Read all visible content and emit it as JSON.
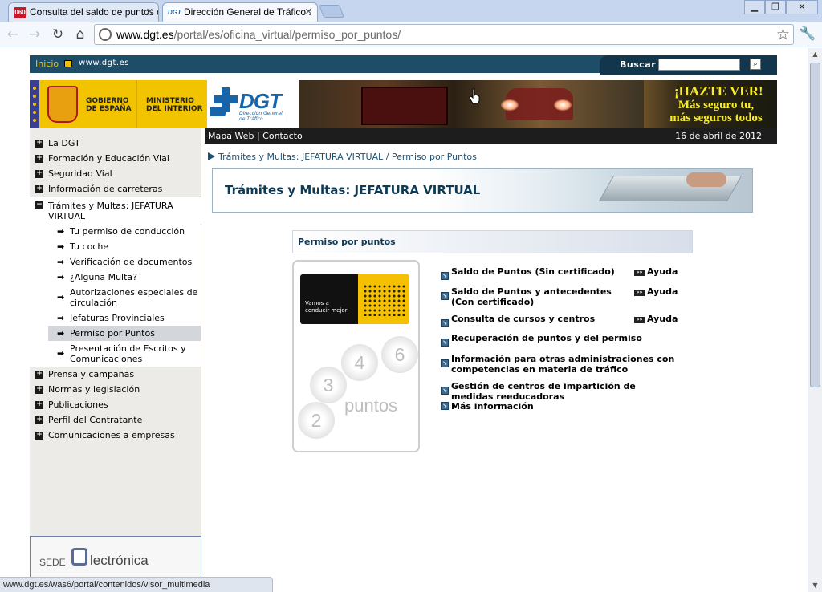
{
  "browser": {
    "tabs": [
      {
        "label": "Consulta del saldo de puntos c",
        "favicon": "060",
        "active": false
      },
      {
        "label": "Dirección General de Tráfico :",
        "favicon": "DGT",
        "active": true
      }
    ],
    "url_host": "www.dgt.es",
    "url_path": "/portal/es/oficina_virtual/permiso_por_puntos/",
    "status_text": "www.dgt.es/was6/portal/contenidos/visor_multimedia"
  },
  "topbar": {
    "inicio": "Inicio",
    "site": "www.dgt.es",
    "search_label": "Buscar",
    "search_value": ""
  },
  "banner": {
    "gobierno_line1": "GOBIERNO",
    "gobierno_line2": "DE ESPAÑA",
    "ministerio_line1": "MINISTERIO",
    "ministerio_line2": "DEL INTERIOR",
    "dgt_word": "DGT",
    "dgt_sub_line1": "Dirección General",
    "dgt_sub_line2": "de Tráfico",
    "hazte_title": "¡HAZTE VER!",
    "hazte_line1": "Más seguro tu,",
    "hazte_line2": "más seguros todos"
  },
  "subbar": {
    "mapa_web": "Mapa Web",
    "separator": "|",
    "contacto": "Contacto",
    "date": "16 de abril de 2012"
  },
  "sidebar": {
    "items_before": [
      {
        "label": "La DGT",
        "sign": "+"
      },
      {
        "label": "Formación y Educación Vial",
        "sign": "+"
      },
      {
        "label": "Seguridad Vial",
        "sign": "+"
      },
      {
        "label": "Información de carreteras",
        "sign": "+"
      }
    ],
    "open_item": {
      "label": "Trámites y Multas: JEFATURA VIRTUAL",
      "sign": "−"
    },
    "sub_items": [
      {
        "label": "Tu permiso de conducción"
      },
      {
        "label": "Tu coche"
      },
      {
        "label": "Verificación de documentos"
      },
      {
        "label": "¿Alguna Multa?"
      },
      {
        "label": "Autorizaciones especiales de circulación"
      },
      {
        "label": "Jefaturas Provinciales"
      },
      {
        "label": "Permiso por Puntos"
      },
      {
        "label": "Presentación de Escritos y Comunicaciones"
      }
    ],
    "items_after": [
      {
        "label": "Prensa y campañas",
        "sign": "+"
      },
      {
        "label": "Normas y legislación",
        "sign": "+"
      },
      {
        "label": "Publicaciones",
        "sign": "+"
      },
      {
        "label": "Perfil del Contratante",
        "sign": "+"
      },
      {
        "label": "Comunicaciones a empresas",
        "sign": "+"
      }
    ],
    "sede_prefix": "SEDE",
    "sede_word": "lectrónica"
  },
  "main": {
    "breadcrumb_1": "Trámites y Multas: JEFATURA VIRTUAL",
    "breadcrumb_sep": "/",
    "breadcrumb_2": "Permiso por Puntos",
    "section_title": "Trámites y Multas: JEFATURA VIRTUAL",
    "panel_title": "Permiso por puntos",
    "card": {
      "tagline_1": "Vamos a",
      "tagline_2": "conducir mejor",
      "numbers": [
        "2",
        "3",
        "4",
        "6"
      ],
      "puntos": "puntos"
    },
    "links": [
      {
        "label": "Saldo de Puntos (Sin certificado)",
        "help": "Ayuda"
      },
      {
        "label": "Saldo de Puntos y antecedentes (Con certificado)",
        "help": "Ayuda"
      },
      {
        "label": "Consulta de cursos y centros",
        "help": "Ayuda"
      },
      {
        "label": "Recuperación de puntos y del permiso",
        "help": ""
      },
      {
        "label": "Información para otras administraciones con competencias en materia de tráfico",
        "help": ""
      },
      {
        "label": "Gestión de centros de impartición de medidas reeducadoras",
        "help": ""
      },
      {
        "label": "Más información",
        "help": ""
      }
    ]
  },
  "colors": {
    "topbar": "#1e4d68",
    "accent_yellow": "#f0c000",
    "dgt_blue": "#1764a8",
    "sidebar_bg": "#edebe8"
  },
  "icons": [
    "back-arrow-icon",
    "forward-arrow-icon",
    "reload-icon",
    "home-icon",
    "globe-icon",
    "star-icon",
    "wrench-icon",
    "search-icon",
    "plus-icon",
    "minus-icon",
    "arrow-right-icon",
    "link-arrow-icon",
    "help-icon"
  ]
}
